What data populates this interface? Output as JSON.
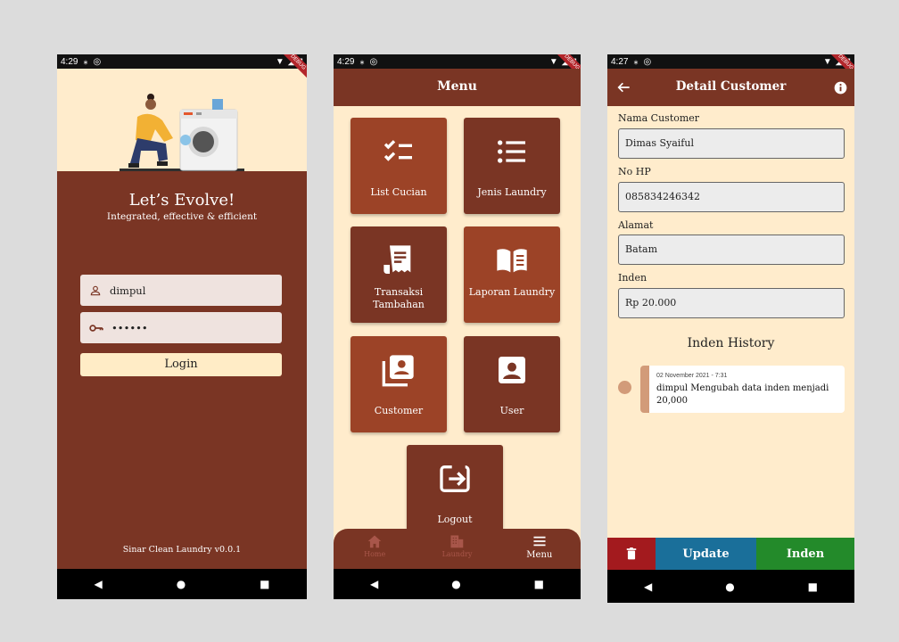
{
  "phone1": {
    "status": {
      "time": "4:29"
    },
    "debug_banner": "DEBUG",
    "headline": "Let’s Evolve!",
    "tagline": "Integrated, effective & efficient",
    "username": {
      "value": "dimpul",
      "icon": "person-icon"
    },
    "password": {
      "value": "••••••",
      "icon": "key-icon"
    },
    "login_label": "Login",
    "footer": "Sinar Clean Laundry v0.0.1"
  },
  "phone2": {
    "status": {
      "time": "4:29"
    },
    "debug_banner": "DEBUG",
    "title": "Menu",
    "tiles": [
      {
        "label": "List Cucian",
        "icon": "checklist-icon"
      },
      {
        "label": "Jenis Laundry",
        "icon": "list-icon"
      },
      {
        "label": "Transaksi Tambahan",
        "icon": "receipt-icon"
      },
      {
        "label": "Laporan Laundry",
        "icon": "book-icon"
      },
      {
        "label": "Customer",
        "icon": "contacts-stack-icon"
      },
      {
        "label": "User",
        "icon": "account-box-icon"
      },
      {
        "label": "Logout",
        "icon": "exit-icon"
      }
    ],
    "bottom_nav": [
      {
        "label": "Home",
        "icon": "home-icon"
      },
      {
        "label": "Laundry",
        "icon": "building-icon"
      },
      {
        "label": "Menu",
        "icon": "menu-icon"
      }
    ]
  },
  "phone3": {
    "status": {
      "time": "4:27"
    },
    "debug_banner": "DEBUG",
    "title": "Detail Customer",
    "fields": [
      {
        "label": "Nama Customer",
        "value": "Dimas Syaiful"
      },
      {
        "label": "No HP",
        "value": "085834246342"
      },
      {
        "label": "Alamat",
        "value": "Batam"
      },
      {
        "label": "Inden",
        "value": "Rp 20.000"
      }
    ],
    "history_title": "Inden History",
    "history": [
      {
        "date": "02 November 2021 - 7:31",
        "text": "dimpul Mengubah data inden menjadi 20,000"
      }
    ],
    "actions": {
      "update": "Update",
      "inden": "Inden"
    }
  },
  "colors": {
    "brown": "#7a3524",
    "cream": "#ffeccc",
    "tile_light": "#9c4327",
    "tile_dark": "#7a3524",
    "delete": "#a31a1e",
    "update": "#1a6f9a",
    "inden": "#238a2a"
  }
}
